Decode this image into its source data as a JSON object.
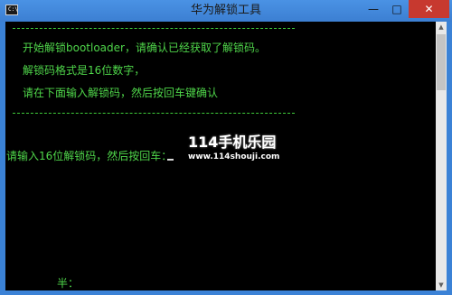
{
  "window": {
    "title": "华为解锁工具",
    "icon": "console-app-icon",
    "controls": {
      "minimize": "—",
      "maximize": "□",
      "close": "✕"
    }
  },
  "console": {
    "separator_top": "-----------------------------------------------------",
    "line1": "开始解锁bootloader，请确认已经获取了解锁码。",
    "line2": "解锁码格式是16位数字，",
    "line3": "请在下面输入解锁码，然后按回车键确认",
    "separator_bottom": "-----------------------------------------------------",
    "prompt": "请输入16位解锁码，然后按回车：",
    "bottom_text": "半："
  },
  "watermark": {
    "brand": "114手机乐园",
    "url": "www.114shouji.com"
  },
  "colors": {
    "terminal_text": "#4fd64a",
    "terminal_bg": "#000000",
    "title_bar": "#3c7fd2",
    "close_button": "#c7392f"
  }
}
